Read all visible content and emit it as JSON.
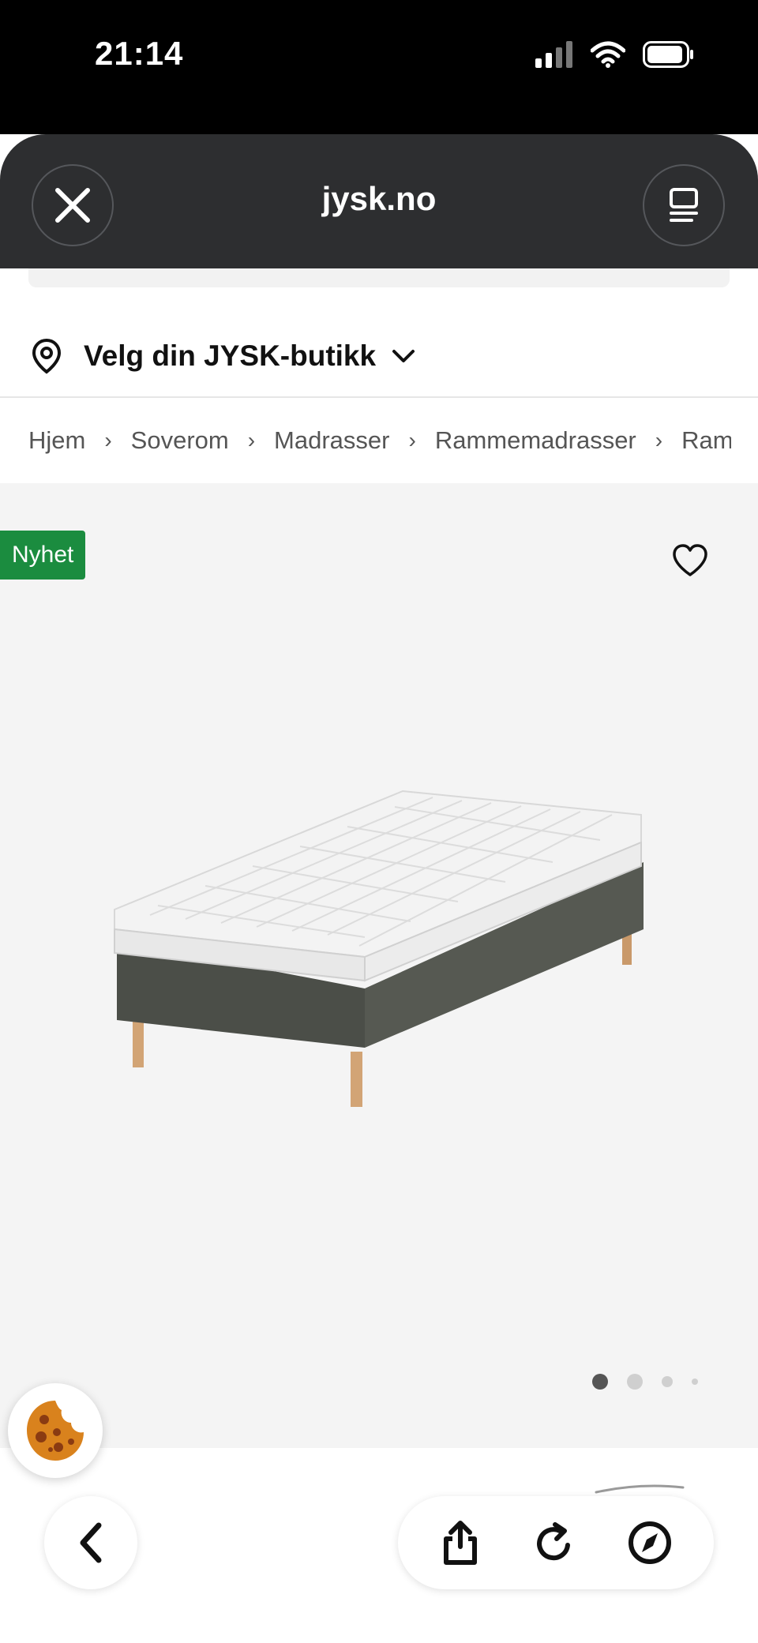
{
  "status_bar": {
    "time": "21:14",
    "icons": [
      "cellular-signal-icon",
      "wifi-icon",
      "battery-icon"
    ]
  },
  "browser": {
    "domain": "jysk.no",
    "close_icon": "close-icon",
    "reader_icon": "reader-icon"
  },
  "store_selector": {
    "label": "Velg din JYSK-butikk",
    "icon": "location-pin-icon",
    "chevron": "chevron-down-icon"
  },
  "breadcrumb": {
    "items": [
      "Hjem",
      "Soverom",
      "Madrasser",
      "Rammemadrasser",
      "Ramm"
    ]
  },
  "product": {
    "badge": "Nyhet",
    "badge_color": "#1b8c3f",
    "favorite_icon": "heart-icon",
    "image": "bed-with-mattress-image",
    "gallery": {
      "total_dots": 4,
      "active_index": 0
    }
  },
  "cookie_button": {
    "icon": "cookie-icon"
  },
  "bottom_nav": {
    "back_icon": "back-arrow-icon",
    "share_icon": "share-icon",
    "reload_icon": "reload-icon",
    "compass_icon": "compass-icon"
  }
}
